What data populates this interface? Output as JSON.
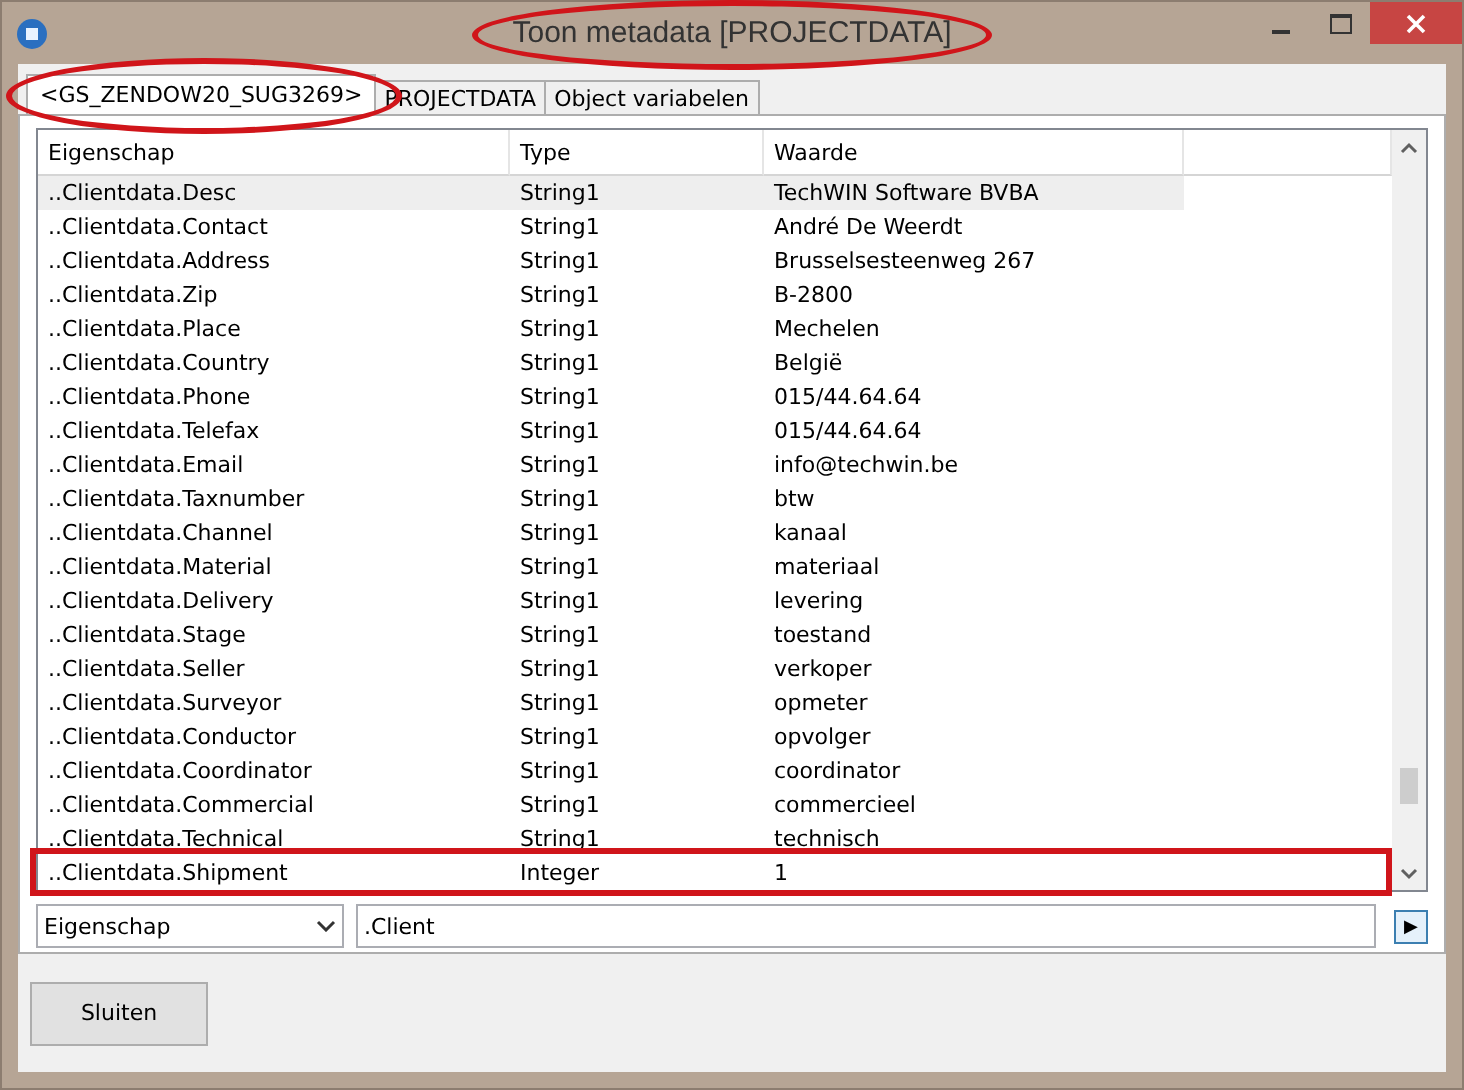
{
  "window": {
    "title": "Toon metadata [PROJECTDATA]",
    "circled": true
  },
  "tabs": [
    {
      "label": "<GS_ZENDOW20_SUG3269>",
      "selected": true,
      "circled": true
    },
    {
      "label": "PROJECTDATA",
      "selected": false,
      "circled": false
    },
    {
      "label": "Object variabelen",
      "selected": false,
      "circled": false
    }
  ],
  "table": {
    "columns": [
      "Eigenschap",
      "Type",
      "Waarde"
    ],
    "rows": [
      {
        "cells": [
          "..Clientdata.Desc",
          "String1",
          "TechWIN Software BVBA"
        ],
        "selected": true,
        "boxed": false
      },
      {
        "cells": [
          "..Clientdata.Contact",
          "String1",
          "André De Weerdt"
        ],
        "selected": false,
        "boxed": false
      },
      {
        "cells": [
          "..Clientdata.Address",
          "String1",
          "Brusselsesteenweg 267"
        ],
        "selected": false,
        "boxed": false
      },
      {
        "cells": [
          "..Clientdata.Zip",
          "String1",
          "B-2800"
        ],
        "selected": false,
        "boxed": false
      },
      {
        "cells": [
          "..Clientdata.Place",
          "String1",
          "Mechelen"
        ],
        "selected": false,
        "boxed": false
      },
      {
        "cells": [
          "..Clientdata.Country",
          "String1",
          "België"
        ],
        "selected": false,
        "boxed": false
      },
      {
        "cells": [
          "..Clientdata.Phone",
          "String1",
          "015/44.64.64"
        ],
        "selected": false,
        "boxed": false
      },
      {
        "cells": [
          "..Clientdata.Telefax",
          "String1",
          "015/44.64.64"
        ],
        "selected": false,
        "boxed": false
      },
      {
        "cells": [
          "..Clientdata.Email",
          "String1",
          "info@techwin.be"
        ],
        "selected": false,
        "boxed": false
      },
      {
        "cells": [
          "..Clientdata.Taxnumber",
          "String1",
          "btw"
        ],
        "selected": false,
        "boxed": false
      },
      {
        "cells": [
          "..Clientdata.Channel",
          "String1",
          "kanaal"
        ],
        "selected": false,
        "boxed": false
      },
      {
        "cells": [
          "..Clientdata.Material",
          "String1",
          "materiaal"
        ],
        "selected": false,
        "boxed": false
      },
      {
        "cells": [
          "..Clientdata.Delivery",
          "String1",
          "levering"
        ],
        "selected": false,
        "boxed": false
      },
      {
        "cells": [
          "..Clientdata.Stage",
          "String1",
          "toestand"
        ],
        "selected": false,
        "boxed": false
      },
      {
        "cells": [
          "..Clientdata.Seller",
          "String1",
          "verkoper"
        ],
        "selected": false,
        "boxed": false
      },
      {
        "cells": [
          "..Clientdata.Surveyor",
          "String1",
          "opmeter"
        ],
        "selected": false,
        "boxed": false
      },
      {
        "cells": [
          "..Clientdata.Conductor",
          "String1",
          "opvolger"
        ],
        "selected": false,
        "boxed": false
      },
      {
        "cells": [
          "..Clientdata.Coordinator",
          "String1",
          "coordinator"
        ],
        "selected": false,
        "boxed": false
      },
      {
        "cells": [
          "..Clientdata.Commercial",
          "String1",
          "commercieel"
        ],
        "selected": false,
        "boxed": false
      },
      {
        "cells": [
          "..Clientdata.Technical",
          "String1",
          "technisch"
        ],
        "selected": false,
        "boxed": false
      },
      {
        "cells": [
          "..Clientdata.Shipment",
          "Integer",
          "1"
        ],
        "selected": false,
        "boxed": true
      }
    ]
  },
  "filter": {
    "field": "Eigenschap",
    "value": ".Client",
    "go_button": "▶"
  },
  "buttons": [
    "Sluiten"
  ]
}
